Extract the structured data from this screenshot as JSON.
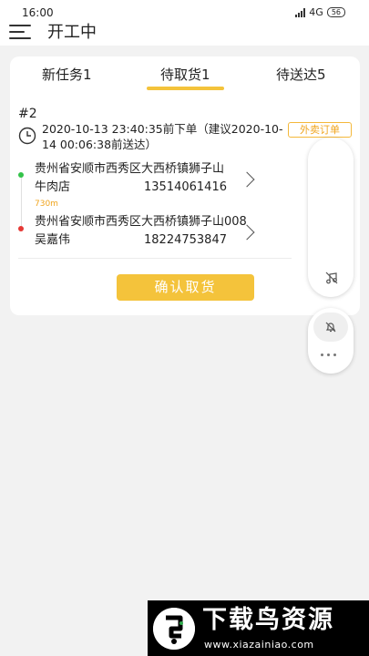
{
  "status_bar": {
    "time": "16:00",
    "network": "4G",
    "battery": "56"
  },
  "header": {
    "title": "开工中",
    "menu_icon": "hamburger-menu-icon"
  },
  "tabs": [
    {
      "label": "新任务1",
      "active": false
    },
    {
      "label": "待取货1",
      "active": true
    },
    {
      "label": "待送达5",
      "active": false
    }
  ],
  "order": {
    "number": "#2",
    "time_text": "2020-10-13 23:40:35前下单（建议2020-10-14 00:06:38前送达）",
    "tag": "外卖订单",
    "pickup": {
      "address": "贵州省安顺市西秀区大西桥镇狮子山",
      "name": "牛肉店",
      "phone": "13514061416"
    },
    "distance": "730m",
    "delivery": {
      "address": "贵州省安顺市西秀区大西桥镇狮子山008",
      "name": "吴嘉伟",
      "phone": "18224753847"
    },
    "confirm_label": "确认取货"
  },
  "floating_tools": {
    "icons": [
      "music-note-off-icon",
      "bell-off-icon",
      "more-icon"
    ]
  },
  "watermark": {
    "title": "下载鸟资源",
    "url": "www.xiazainiao.com"
  },
  "colors": {
    "accent": "#f4c33b",
    "tag": "#f0a51f",
    "pickup_dot": "#34c34a",
    "delivery_dot": "#e53935"
  }
}
